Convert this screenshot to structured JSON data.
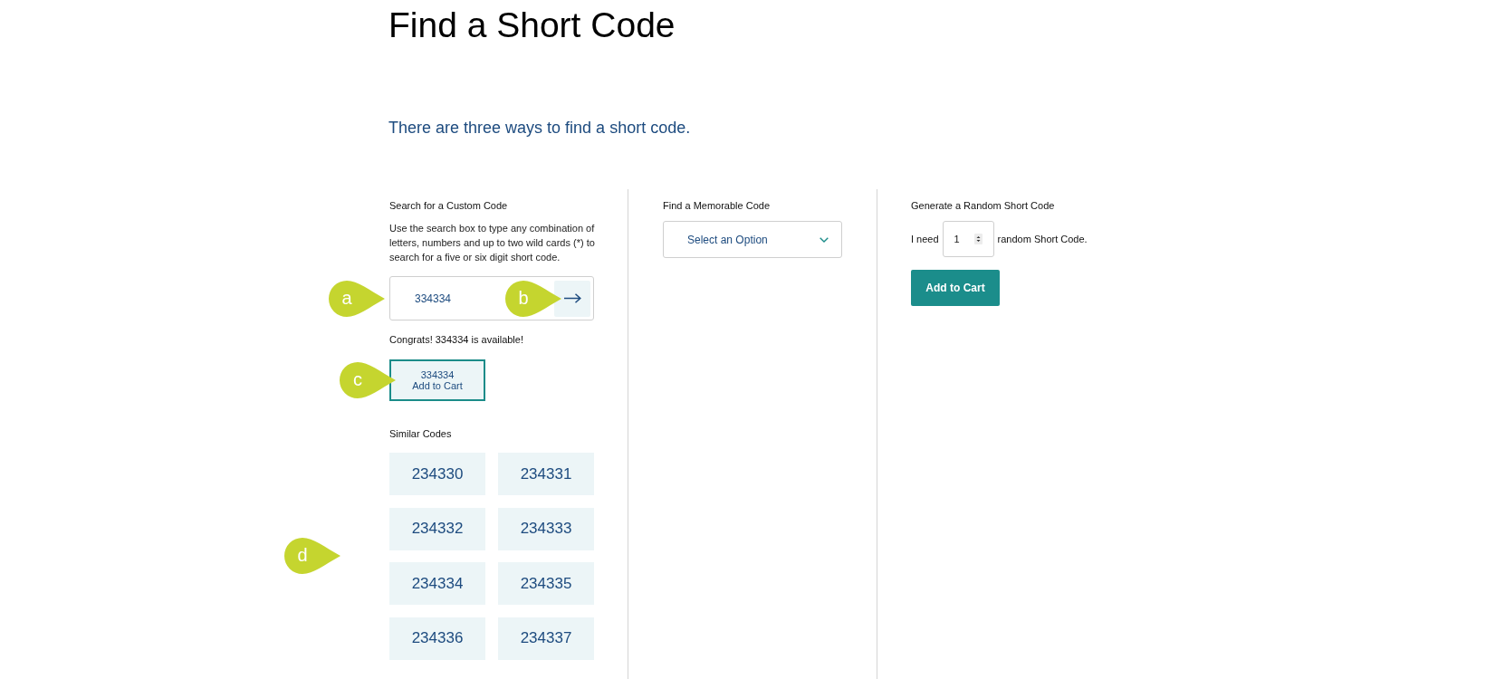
{
  "page": {
    "title": "Find a Short Code",
    "subtitle": "There are three ways to find a short code."
  },
  "custom": {
    "heading": "Search for a Custom Code",
    "description": "Use the search box to type any combination of letters, numbers and up to two wild cards (*) to search for a five or six digit short code.",
    "search": {
      "value": "334334",
      "callout": "a",
      "button_callout": "b"
    },
    "message": "Congrats! 334334 is available!",
    "result_button": {
      "code": "334334",
      "label": "Add to Cart",
      "callout": "c"
    },
    "similar": {
      "heading": "Similar Codes",
      "callout": "d",
      "codes": [
        "234330",
        "234331",
        "234332",
        "234333",
        "234334",
        "234335",
        "234336",
        "234337"
      ]
    }
  },
  "memorable": {
    "heading": "Find a Memorable Code",
    "select": {
      "placeholder": "Select an Option"
    }
  },
  "random": {
    "heading": "Generate a Random Short Code",
    "prefix": "I need",
    "quantity": "1",
    "suffix": "random Short Code.",
    "button": "Add to Cart"
  }
}
